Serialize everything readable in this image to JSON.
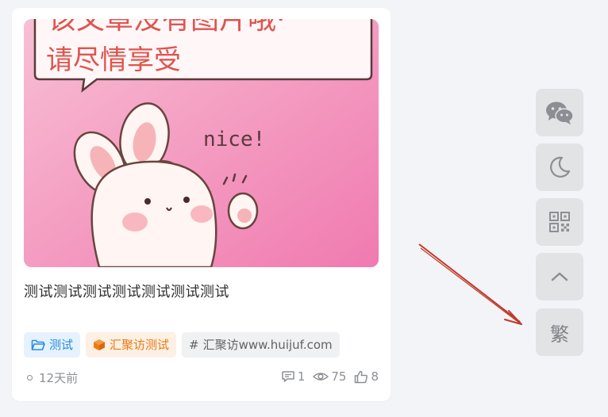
{
  "post": {
    "image_caption_line1": "该文章没有图片哦·",
    "image_caption_line2": "请尽情享受",
    "image_sticker_text": "nice!",
    "title": "测试测试测试测试测试测试测试",
    "tags": [
      {
        "icon": "folder-icon",
        "label": "测试",
        "color": "#2a8be3"
      },
      {
        "icon": "cube-icon",
        "label": "汇聚访测试",
        "color": "#ee7a12"
      },
      {
        "icon": "hash",
        "prefix": "#",
        "label": "汇聚访www.huijuf.com",
        "color": "#606368"
      }
    ],
    "time": "12天前",
    "comments": "1",
    "views": "75",
    "likes": "8"
  },
  "side_buttons": [
    {
      "icon": "wechat-icon"
    },
    {
      "icon": "moon-icon"
    },
    {
      "icon": "qrcode-icon"
    },
    {
      "icon": "chevron-up-icon"
    },
    {
      "icon": "traditional-chinese-toggle",
      "label": "繁"
    }
  ],
  "annotation": {
    "color": "#c0392b"
  }
}
